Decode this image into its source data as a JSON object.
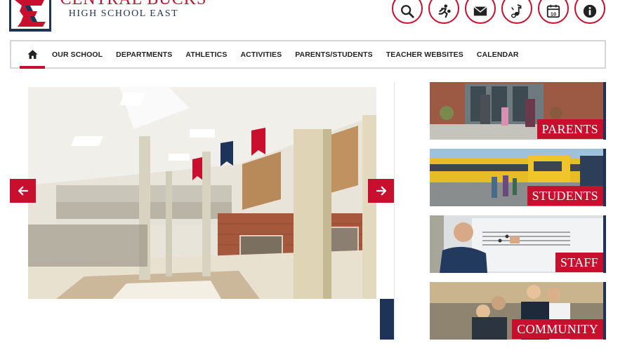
{
  "header": {
    "school_name": "CENTRAL BUCKS",
    "school_subtitle": "HIGH SCHOOL EAST",
    "logo_icon": "cb-east-logo-icon"
  },
  "top_icons": [
    {
      "name": "search-icon"
    },
    {
      "name": "athletics-runner-icon"
    },
    {
      "name": "mail-icon"
    },
    {
      "name": "music-notes-icon"
    },
    {
      "name": "calendar-10-icon",
      "text": "10"
    },
    {
      "name": "info-icon"
    }
  ],
  "nav": {
    "home_icon": "home-icon",
    "items": [
      "OUR SCHOOL",
      "DEPARTMENTS",
      "ATHLETICS",
      "ACTIVITIES",
      "PARENTS/STUDENTS",
      "TEACHER WEBSITES",
      "CALENDAR"
    ]
  },
  "slideshow": {
    "prev_icon": "arrow-left-icon",
    "next_icon": "arrow-right-icon"
  },
  "tiles": [
    {
      "label": "PARENTS"
    },
    {
      "label": "STUDENTS"
    },
    {
      "label": "STAFF"
    },
    {
      "label": "COMMUNITY"
    }
  ],
  "colors": {
    "brand_red": "#c8102e",
    "brand_navy": "#1e3358"
  }
}
